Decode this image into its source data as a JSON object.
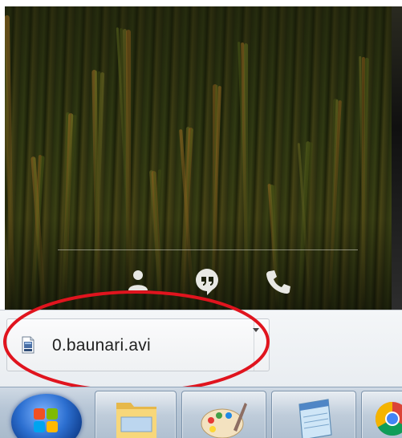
{
  "download_bar": {
    "file_name": "0.baunari.avi",
    "file_icon": "video-file-icon",
    "menu_icon": "chevron-down-icon"
  },
  "overlay_controls": {
    "icons": [
      "person-icon",
      "hangouts-chat-icon",
      "phone-icon"
    ]
  },
  "taskbar": {
    "start_icon": "windows-start-orb-icon",
    "pinned": [
      {
        "icon": "windows-explorer-folder-icon"
      },
      {
        "icon": "paint-palette-icon"
      },
      {
        "icon": "notepad-icon"
      },
      {
        "icon": "chrome-icon"
      }
    ]
  },
  "colors": {
    "highlight_ellipse": "#e0141e",
    "taskbar": "#b7c6d6",
    "download_bar": "#eef1f4"
  }
}
